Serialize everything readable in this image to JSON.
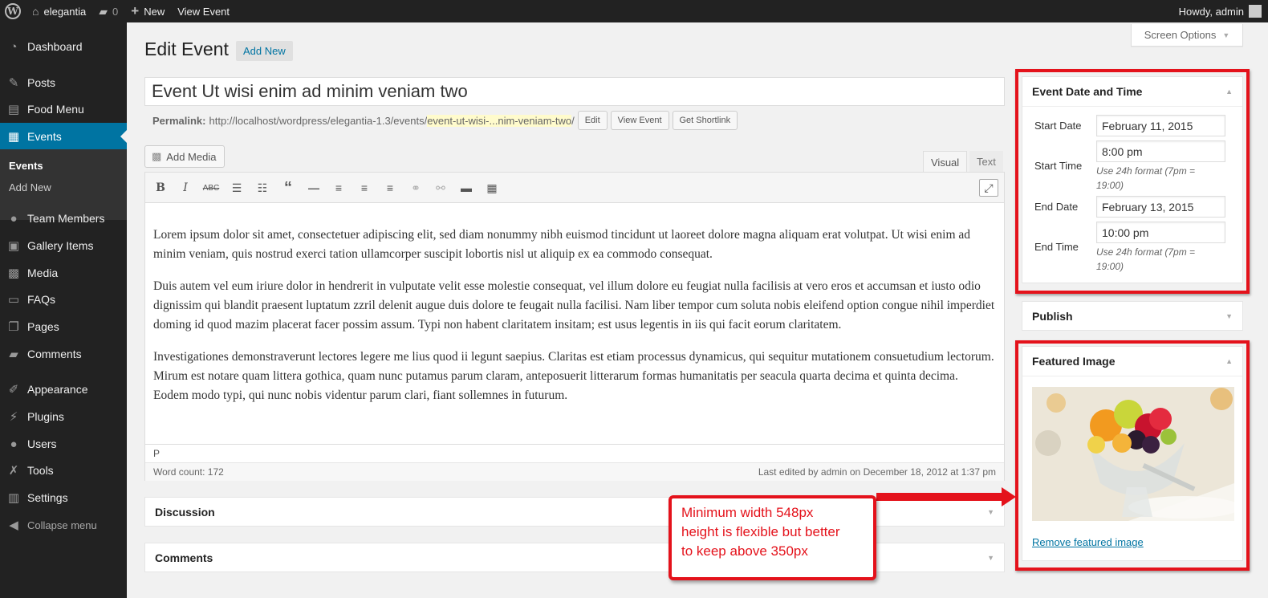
{
  "adminbar": {
    "site_name": "elegantia",
    "comments_count": "0",
    "new_label": "New",
    "view_label": "View Event",
    "howdy": "Howdy, admin"
  },
  "menu": {
    "dashboard": "Dashboard",
    "posts": "Posts",
    "food_menu": "Food Menu",
    "events": "Events",
    "sub_events": "Events",
    "sub_add_new": "Add New",
    "team_members": "Team Members",
    "gallery_items": "Gallery Items",
    "media": "Media",
    "faqs": "FAQs",
    "pages": "Pages",
    "comments": "Comments",
    "appearance": "Appearance",
    "plugins": "Plugins",
    "users": "Users",
    "tools": "Tools",
    "settings": "Settings",
    "collapse": "Collapse menu"
  },
  "screen_options": "Screen Options",
  "page": {
    "title": "Edit Event",
    "add_new": "Add New",
    "post_title": "Event Ut wisi enim ad minim veniam two",
    "permalink_label": "Permalink:",
    "permalink_base": "http://localhost/wordpress/elegantia-1.3/events/",
    "permalink_slug": "event-ut-wisi-...nim-veniam-two",
    "permalink_trail": "/",
    "btn_edit": "Edit",
    "btn_view": "View Event",
    "btn_shortlink": "Get Shortlink"
  },
  "editor": {
    "add_media": "Add Media",
    "tab_visual": "Visual",
    "tab_text": "Text",
    "paragraphs": [
      "Lorem ipsum dolor sit amet, consectetuer adipiscing elit, sed diam nonummy nibh euismod tincidunt ut laoreet dolore magna aliquam erat volutpat. Ut wisi enim ad minim veniam, quis nostrud exerci tation ullamcorper suscipit lobortis nisl ut aliquip ex ea commodo consequat.",
      "Duis autem vel eum iriure dolor in hendrerit in vulputate velit esse molestie consequat, vel illum dolore eu feugiat nulla facilisis at vero eros et accumsan et iusto odio dignissim qui blandit praesent luptatum zzril delenit augue duis dolore te feugait nulla facilisi. Nam liber tempor cum soluta nobis eleifend option congue nihil imperdiet doming id quod mazim placerat facer possim assum. Typi non habent claritatem insitam; est usus legentis in iis qui facit eorum claritatem.",
      "Investigationes demonstraverunt lectores legere me lius quod ii legunt saepius. Claritas est etiam processus dynamicus, qui sequitur mutationem consuetudium lectorum. Mirum est notare quam littera gothica, quam nunc putamus parum claram, anteposuerit litterarum formas humanitatis per seacula quarta decima et quinta decima. Eodem modo typi, qui nunc nobis videntur parum clari, fiant sollemnes in futurum."
    ],
    "path": "P",
    "word_count": "Word count: 172",
    "last_edited": "Last edited by admin on December 18, 2012 at 1:37 pm"
  },
  "metaboxes": {
    "discussion": "Discussion",
    "comments": "Comments",
    "event": {
      "title": "Event Date and Time",
      "start_date_label": "Start Date",
      "start_date": "February 11, 2015",
      "start_time_label": "Start Time",
      "start_time": "8:00 pm",
      "start_time_hint": "Use 24h format (7pm = 19:00)",
      "end_date_label": "End Date",
      "end_date": "February 13, 2015",
      "end_time_label": "End Time",
      "end_time": "10:00 pm",
      "end_time_hint": "Use 24h format (7pm = 19:00)"
    },
    "publish": "Publish",
    "featured": {
      "title": "Featured Image",
      "remove": "Remove featured image"
    }
  },
  "annotation": {
    "line1": "Minimum width 548px",
    "line2": "height is flexible but better",
    "line3": "to keep above 350px"
  },
  "colors": {
    "accent": "#0074a2",
    "annotation_red": "#e4121b"
  }
}
